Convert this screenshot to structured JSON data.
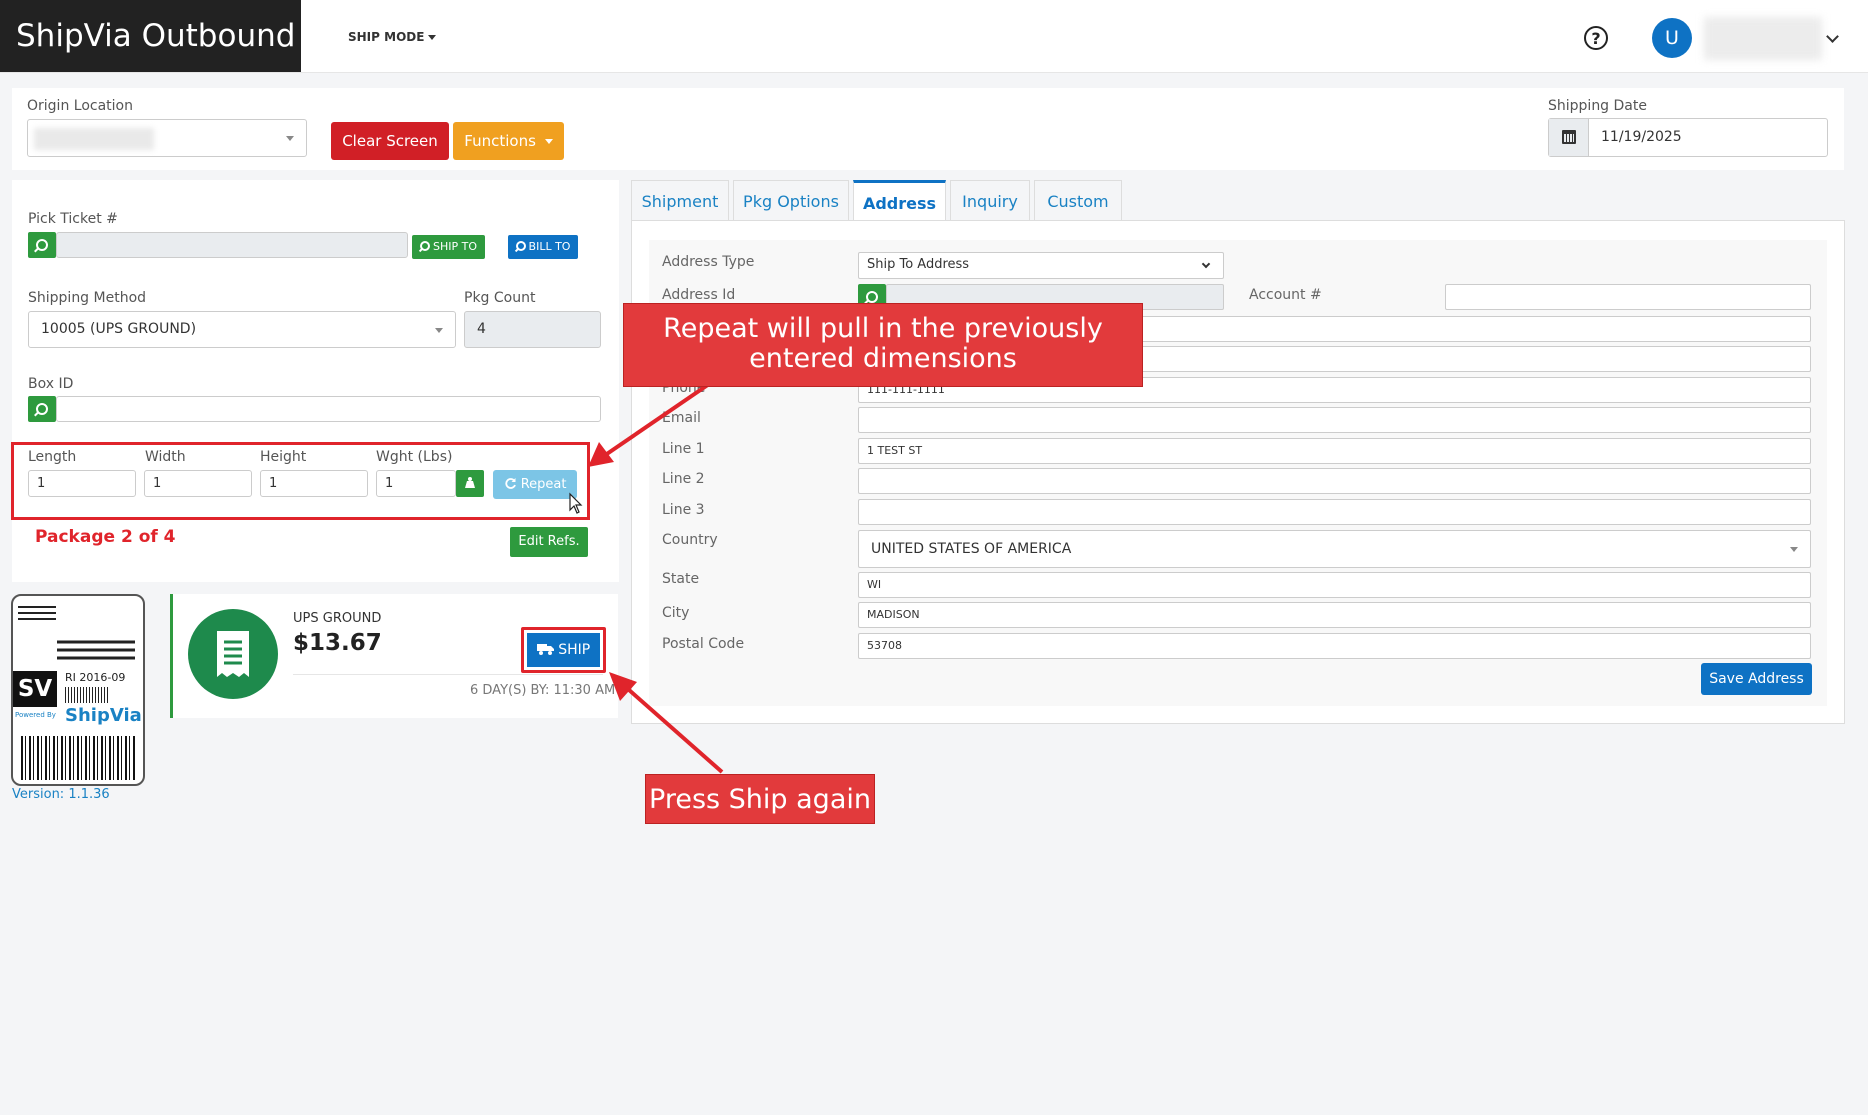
{
  "header": {
    "app_title": "ShipVia Outbound",
    "ship_mode": "SHIP MODE",
    "help": "?",
    "user_initial": "U"
  },
  "toolbar": {
    "origin_label": "Origin Location",
    "clear_screen": "Clear Screen",
    "functions": "Functions",
    "shipping_date_label": "Shipping Date",
    "shipping_date": "11/19/2025"
  },
  "left_form": {
    "pick_ticket_label": "Pick Ticket #",
    "ship_to": "SHIP TO",
    "bill_to": "BILL TO",
    "shipping_method_label": "Shipping Method",
    "shipping_method": "10005 (UPS GROUND)",
    "pkg_count_label": "Pkg Count",
    "pkg_count": "4",
    "box_id_label": "Box ID",
    "length_label": "Length",
    "width_label": "Width",
    "height_label": "Height",
    "weight_label": "Wght (Lbs)",
    "length": "1",
    "width": "1",
    "height": "1",
    "weight": "1",
    "repeat": "Repeat",
    "package_status": "Package 2 of 4",
    "edit_refs": "Edit Refs."
  },
  "label_card": {
    "sv": "SV",
    "code": "RI 2016-09",
    "powered_by": "Powered By",
    "brand": "ShipVia",
    "version": "Version: 1.1.36"
  },
  "rate": {
    "service": "UPS GROUND",
    "price": "$13.67",
    "ship": "SHIP",
    "delivery": "6 DAY(S) BY: 11:30 AM"
  },
  "tabs": [
    "Shipment",
    "Pkg Options",
    "Address",
    "Inquiry",
    "Custom"
  ],
  "address": {
    "address_type_label": "Address Type",
    "address_type": "Ship To Address",
    "address_id_label": "Address Id",
    "account_label": "Account #",
    "phone_label": "Phone",
    "phone": "111-111-1111",
    "email_label": "Email",
    "line1_label": "Line 1",
    "line1": "1 TEST ST",
    "line2_label": "Line 2",
    "line3_label": "Line 3",
    "country_label": "Country",
    "country": "UNITED STATES OF AMERICA",
    "state_label": "State",
    "state": "WI",
    "city_label": "City",
    "city": "MADISON",
    "postal_label": "Postal Code",
    "postal": "53708",
    "save": "Save Address"
  },
  "callouts": {
    "repeat_note": "Repeat will pull in the previously entered dimensions",
    "ship_note": "Press Ship again"
  },
  "colors": {
    "brand_bg": "#222222",
    "clear_screen": "#d11f26",
    "functions": "#f0a020",
    "primary": "#0e72c4",
    "success": "#2e9a3e",
    "annotation": "#e0242b"
  }
}
